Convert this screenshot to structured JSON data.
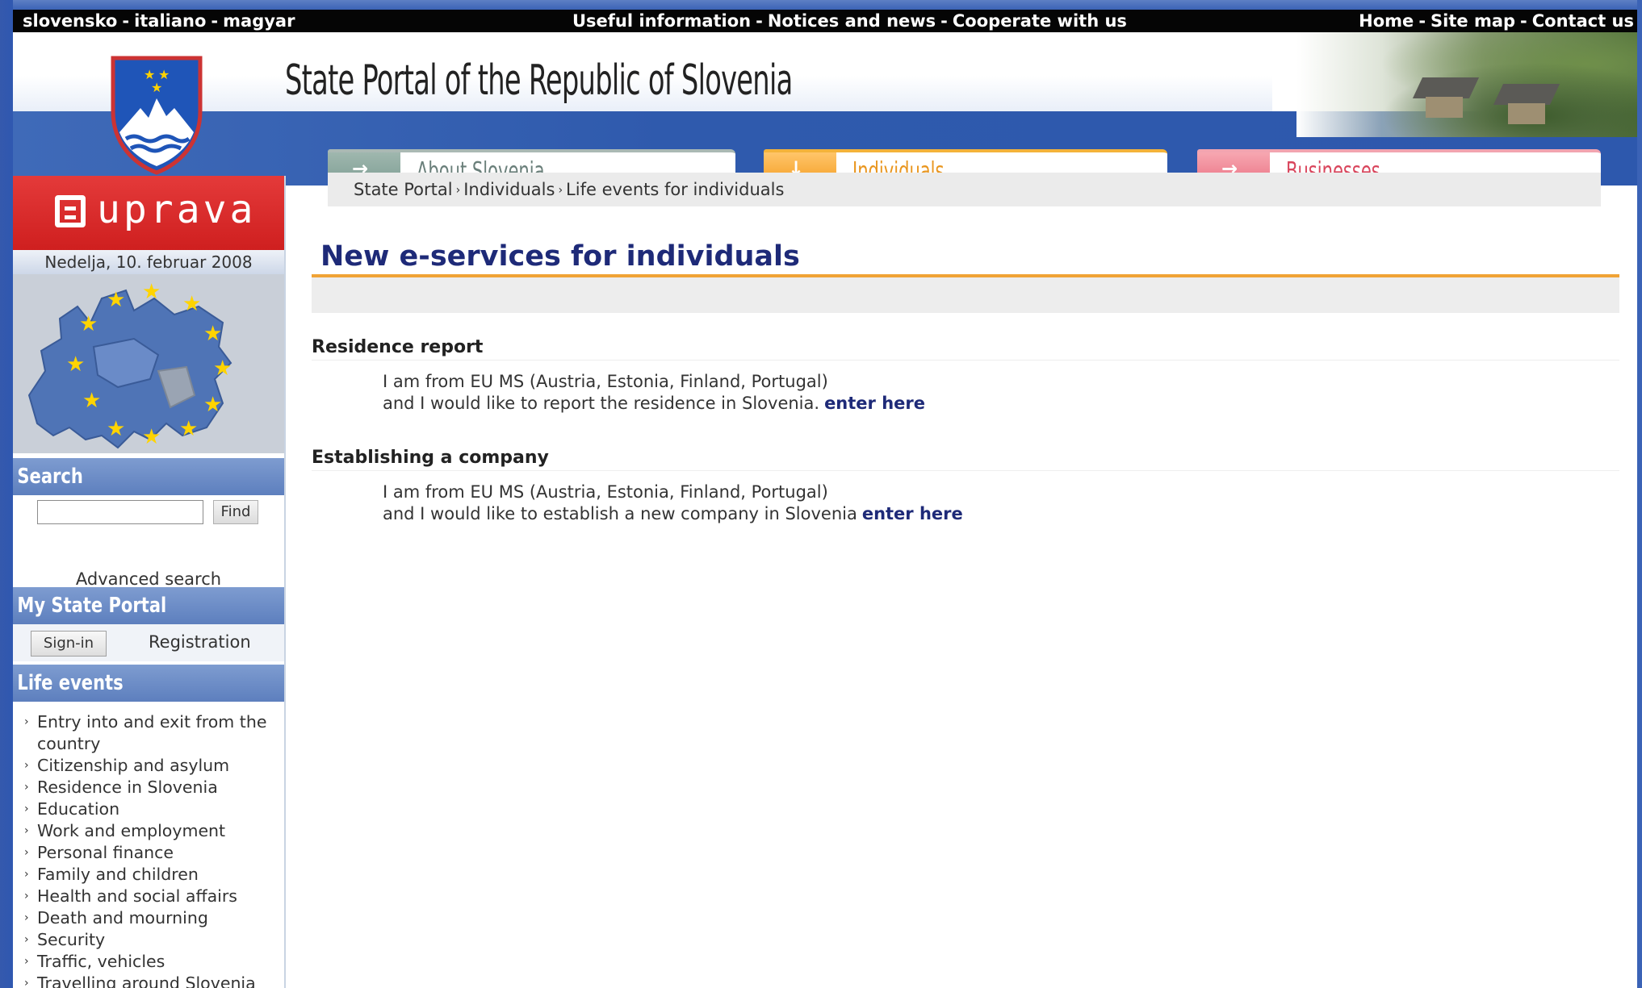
{
  "topbar": {
    "languages": [
      "slovensko",
      "italiano",
      "magyar"
    ],
    "info_links": [
      "Useful information",
      "Notices and news",
      "Cooperate with us"
    ],
    "util_links": [
      "Home",
      "Site map",
      "Contact us"
    ]
  },
  "header": {
    "site_title": "State Portal of the Republic of Slovenia"
  },
  "tabs": [
    {
      "label": "About Slovenia",
      "arrow": "→",
      "state": "inactive"
    },
    {
      "label": "Individuals",
      "arrow": "↓",
      "state": "active"
    },
    {
      "label": "Businesses",
      "arrow": "→",
      "state": "inactive"
    }
  ],
  "breadcrumb": [
    "State Portal",
    "Individuals",
    "Life events for individuals"
  ],
  "sidebar": {
    "logo_text": "uprava",
    "date": "Nedelja, 10. februar 2008",
    "search": {
      "heading": "Search",
      "input_value": "",
      "find_label": "Find",
      "advanced_label": "Advanced search"
    },
    "my_portal": {
      "heading": "My State Portal",
      "signin_label": "Sign-in",
      "registration_label": "Registration"
    },
    "life_events": {
      "heading": "Life events",
      "items": [
        "Entry into and exit from the country",
        "Citizenship and asylum",
        "Residence in Slovenia",
        "Education",
        "Work and employment",
        "Personal finance",
        "Family and children",
        "Health and social affairs",
        "Death and mourning",
        "Security",
        "Traffic, vehicles",
        "Travelling around Slovenia"
      ]
    }
  },
  "main": {
    "title": "New e-services for individuals",
    "sections": [
      {
        "heading": "Residence report",
        "line1": "I am from EU MS (Austria, Estonia, Finland, Portugal)",
        "line2": "and I would like to report the residence in Slovenia.",
        "link": "enter here"
      },
      {
        "heading": "Establishing a company",
        "line1": "I am from EU MS (Austria, Estonia, Finland, Portugal)",
        "line2": "and I would like to establish a new company in Slovenia",
        "link": "enter here"
      }
    ]
  },
  "colors": {
    "accent_orange": "#f0a336",
    "title_navy": "#1e2a78",
    "upr_red": "#d92a2a",
    "sidebar_head_blue": "#6b8bc6"
  }
}
